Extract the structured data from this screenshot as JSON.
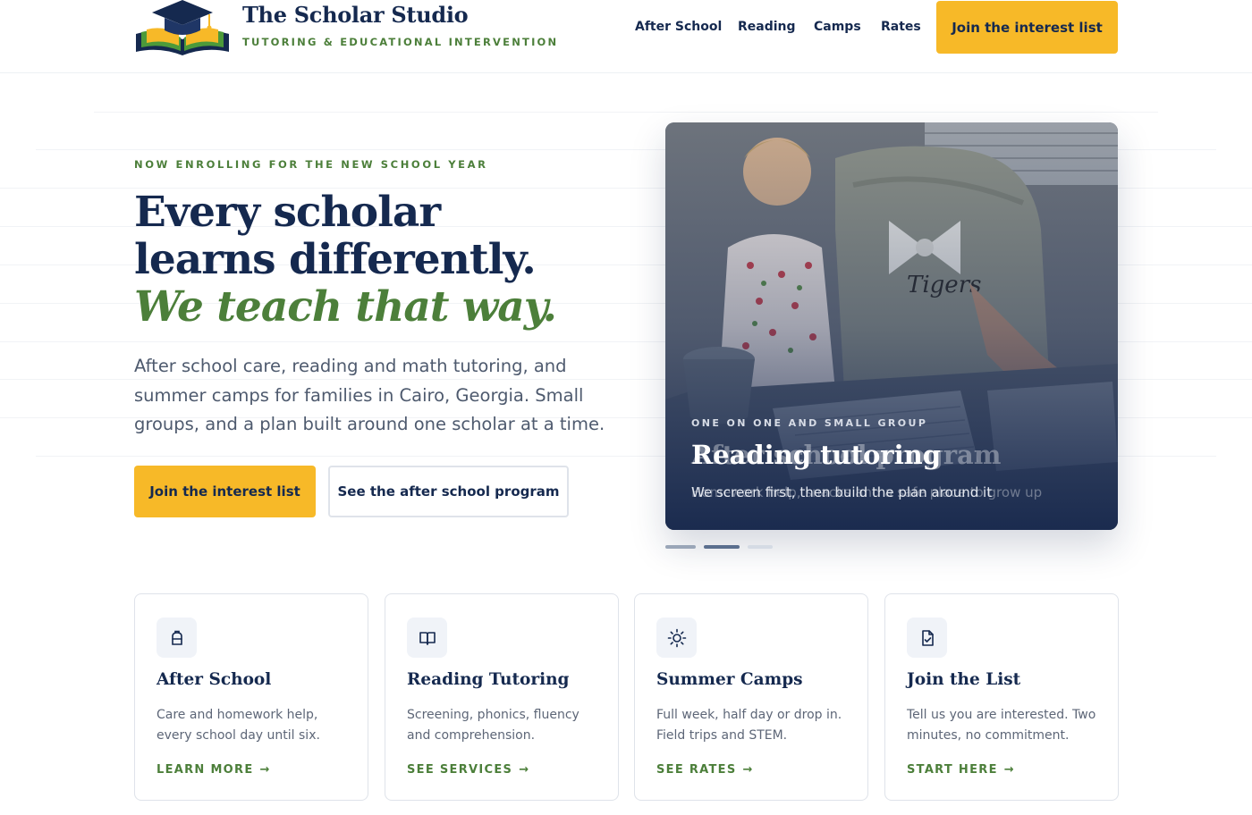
{
  "brand": {
    "name": "The Scholar Studio",
    "tagline": "TUTORING & EDUCATIONAL INTERVENTION"
  },
  "nav": {
    "items": [
      "After School",
      "Reading",
      "Camps",
      "Rates"
    ],
    "cta_label": "Join the interest list"
  },
  "hero": {
    "eyebrow": "NOW ENROLLING FOR THE NEW SCHOOL YEAR",
    "headline_line1": "Every scholar",
    "headline_line2": "learns differently.",
    "headline_accent": "We teach that way.",
    "lead": "After school care, reading and math tutoring, and summer camps for families in Cairo, Georgia. Small groups, and a plan built around one scholar at a time.",
    "primary_label": "Join the interest list",
    "secondary_label": "See the after school program"
  },
  "carousel": {
    "active_index": 1,
    "slide_count": 3,
    "current": {
      "eyebrow": "ONE ON ONE AND SMALL GROUP",
      "title": "Reading tutoring",
      "subtitle": "We screen first, then build the plan around it"
    },
    "fading": {
      "title": "After school program",
      "subtitle": "Homework help, snacks and a safe place to grow up"
    }
  },
  "cards": [
    {
      "icon": "backpack-icon",
      "title": "After School",
      "text": "Care and homework help, every school day until six.",
      "link": "LEARN MORE"
    },
    {
      "icon": "book-open-icon",
      "title": "Reading Tutoring",
      "text": "Screening, phonics, fluency and comprehension.",
      "link": "SEE SERVICES"
    },
    {
      "icon": "sun-icon",
      "title": "Summer Camps",
      "text": "Full week, half day or drop in. Field trips and STEM.",
      "link": "SEE RATES"
    },
    {
      "icon": "clipboard-check-icon",
      "title": "Join the List",
      "text": "Tell us you are interested. Two minutes, no commitment.",
      "link": "START HERE"
    }
  ],
  "colors": {
    "navy": "#15294f",
    "green": "#4c7f3a",
    "gold": "#f7b928",
    "border": "#dfe3ea"
  }
}
